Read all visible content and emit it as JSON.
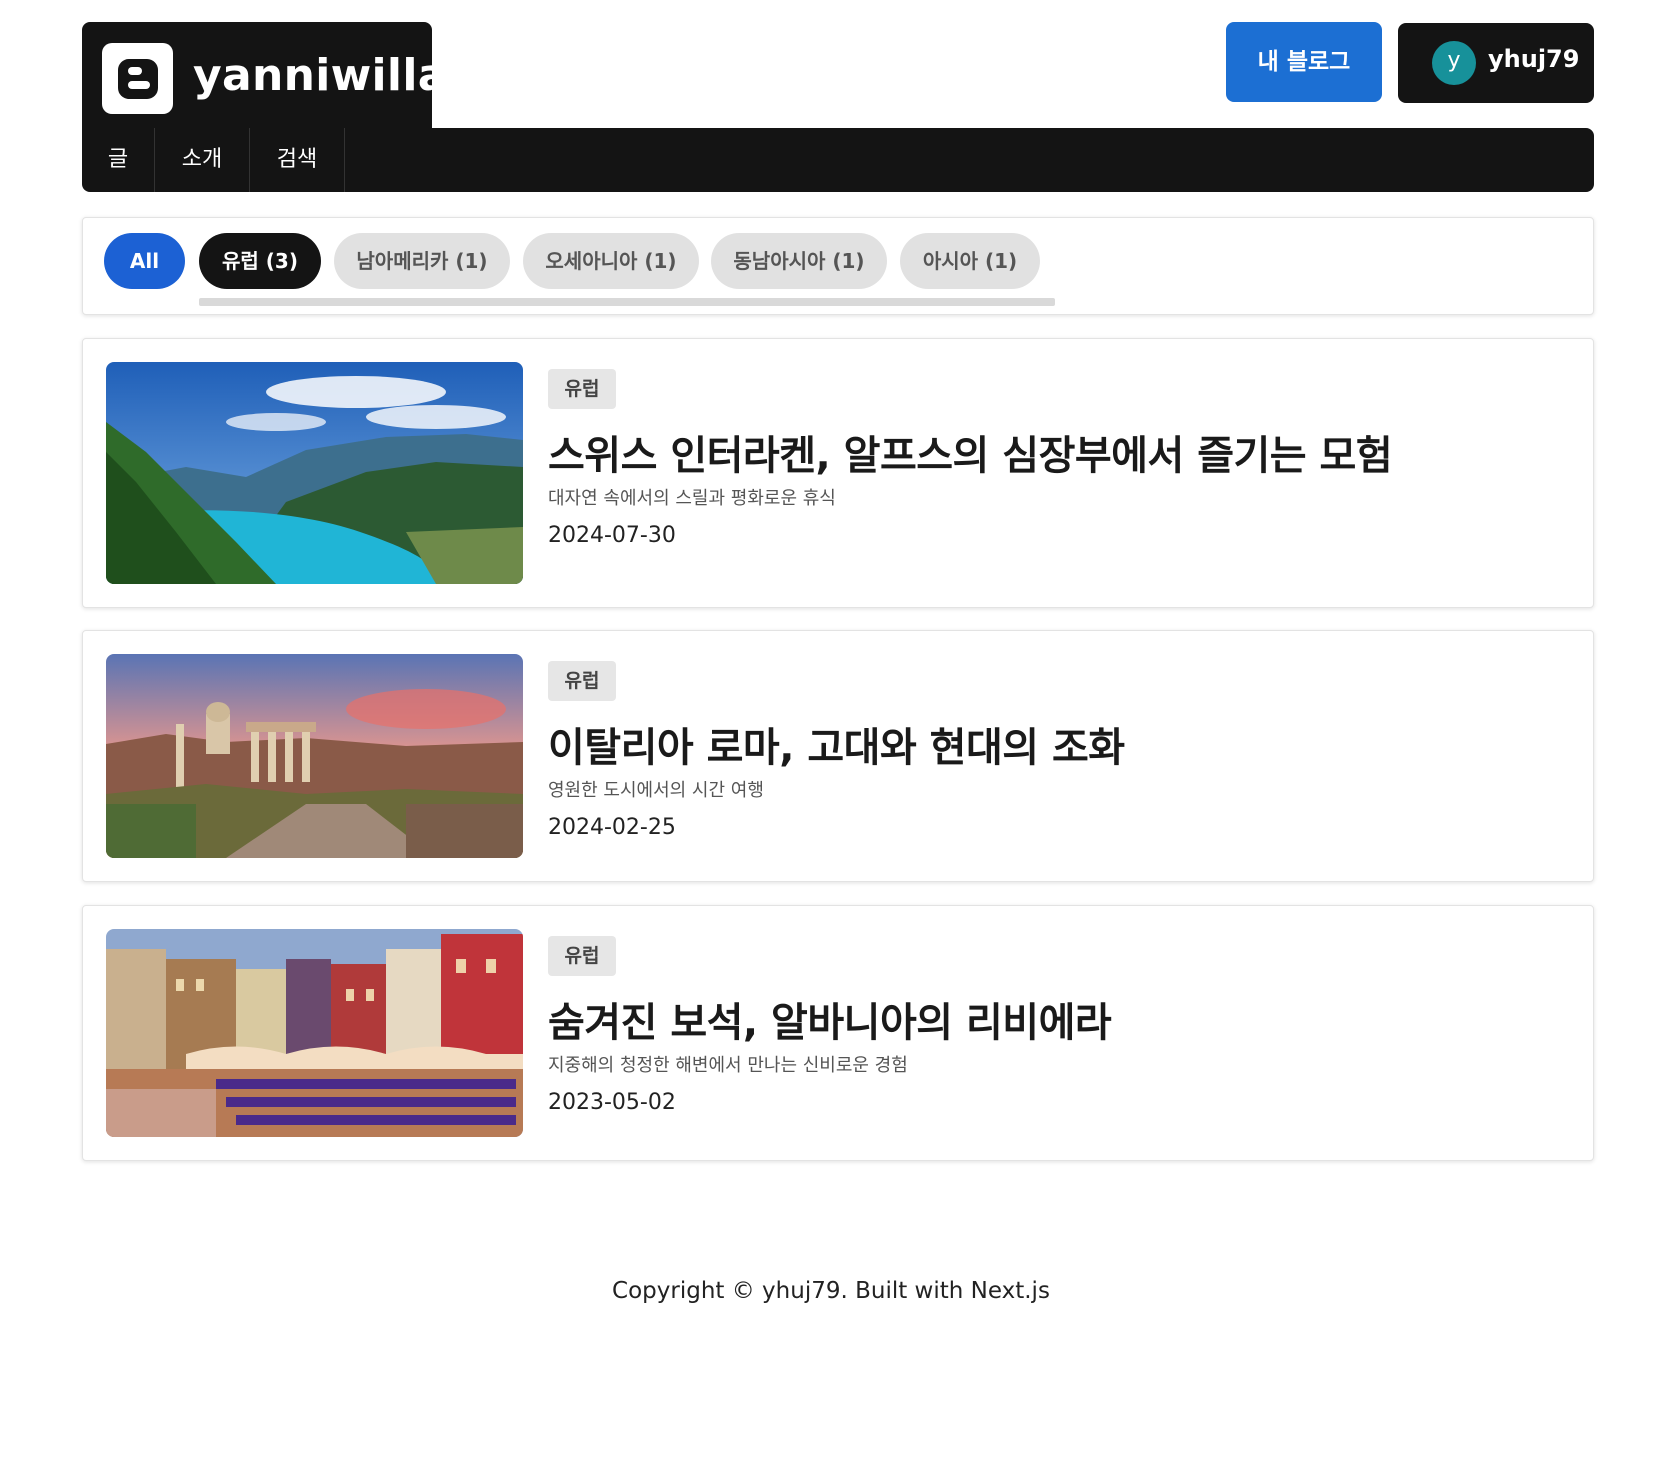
{
  "brand": {
    "name": "yanniwilla",
    "logo_icon": "blogger-icon"
  },
  "nav": {
    "items": [
      {
        "label": "글"
      },
      {
        "label": "소개"
      },
      {
        "label": "검색"
      }
    ]
  },
  "header_actions": {
    "my_blog_label": "내 블로그",
    "user": {
      "avatar_initial": "y",
      "username": "yhuj79",
      "avatar_color": "#17919a"
    }
  },
  "filters": {
    "chips": [
      {
        "label": "All"
      },
      {
        "label": "유럽 (3)"
      },
      {
        "label": "남아메리카 (1)"
      },
      {
        "label": "오세아니아 (1)"
      },
      {
        "label": "동남아시아 (1)"
      },
      {
        "label": "아시아 (1)"
      }
    ],
    "selected": "유럽 (3)"
  },
  "posts": [
    {
      "category": "유럽",
      "title": "스위스 인터라켄, 알프스의 심장부에서 즐기는 모험",
      "subtitle": "대자연 속에서의 스릴과 평화로운 휴식",
      "date": "2024-07-30"
    },
    {
      "category": "유럽",
      "title": "이탈리아 로마, 고대와 현대의 조화",
      "subtitle": "영원한 도시에서의 시간 여행",
      "date": "2024-02-25"
    },
    {
      "category": "유럽",
      "title": "숨겨진 보석, 알바니아의 리비에라",
      "subtitle": "지중해의 청정한 해변에서 만나는 신비로운 경험",
      "date": "2023-05-02"
    }
  ],
  "footer": {
    "text": "Copyright © yhuj79. Built with Next.js"
  },
  "colors": {
    "accent_blue": "#1c6fd3",
    "dark": "#141414",
    "chip_gray": "#e1e1e1"
  }
}
